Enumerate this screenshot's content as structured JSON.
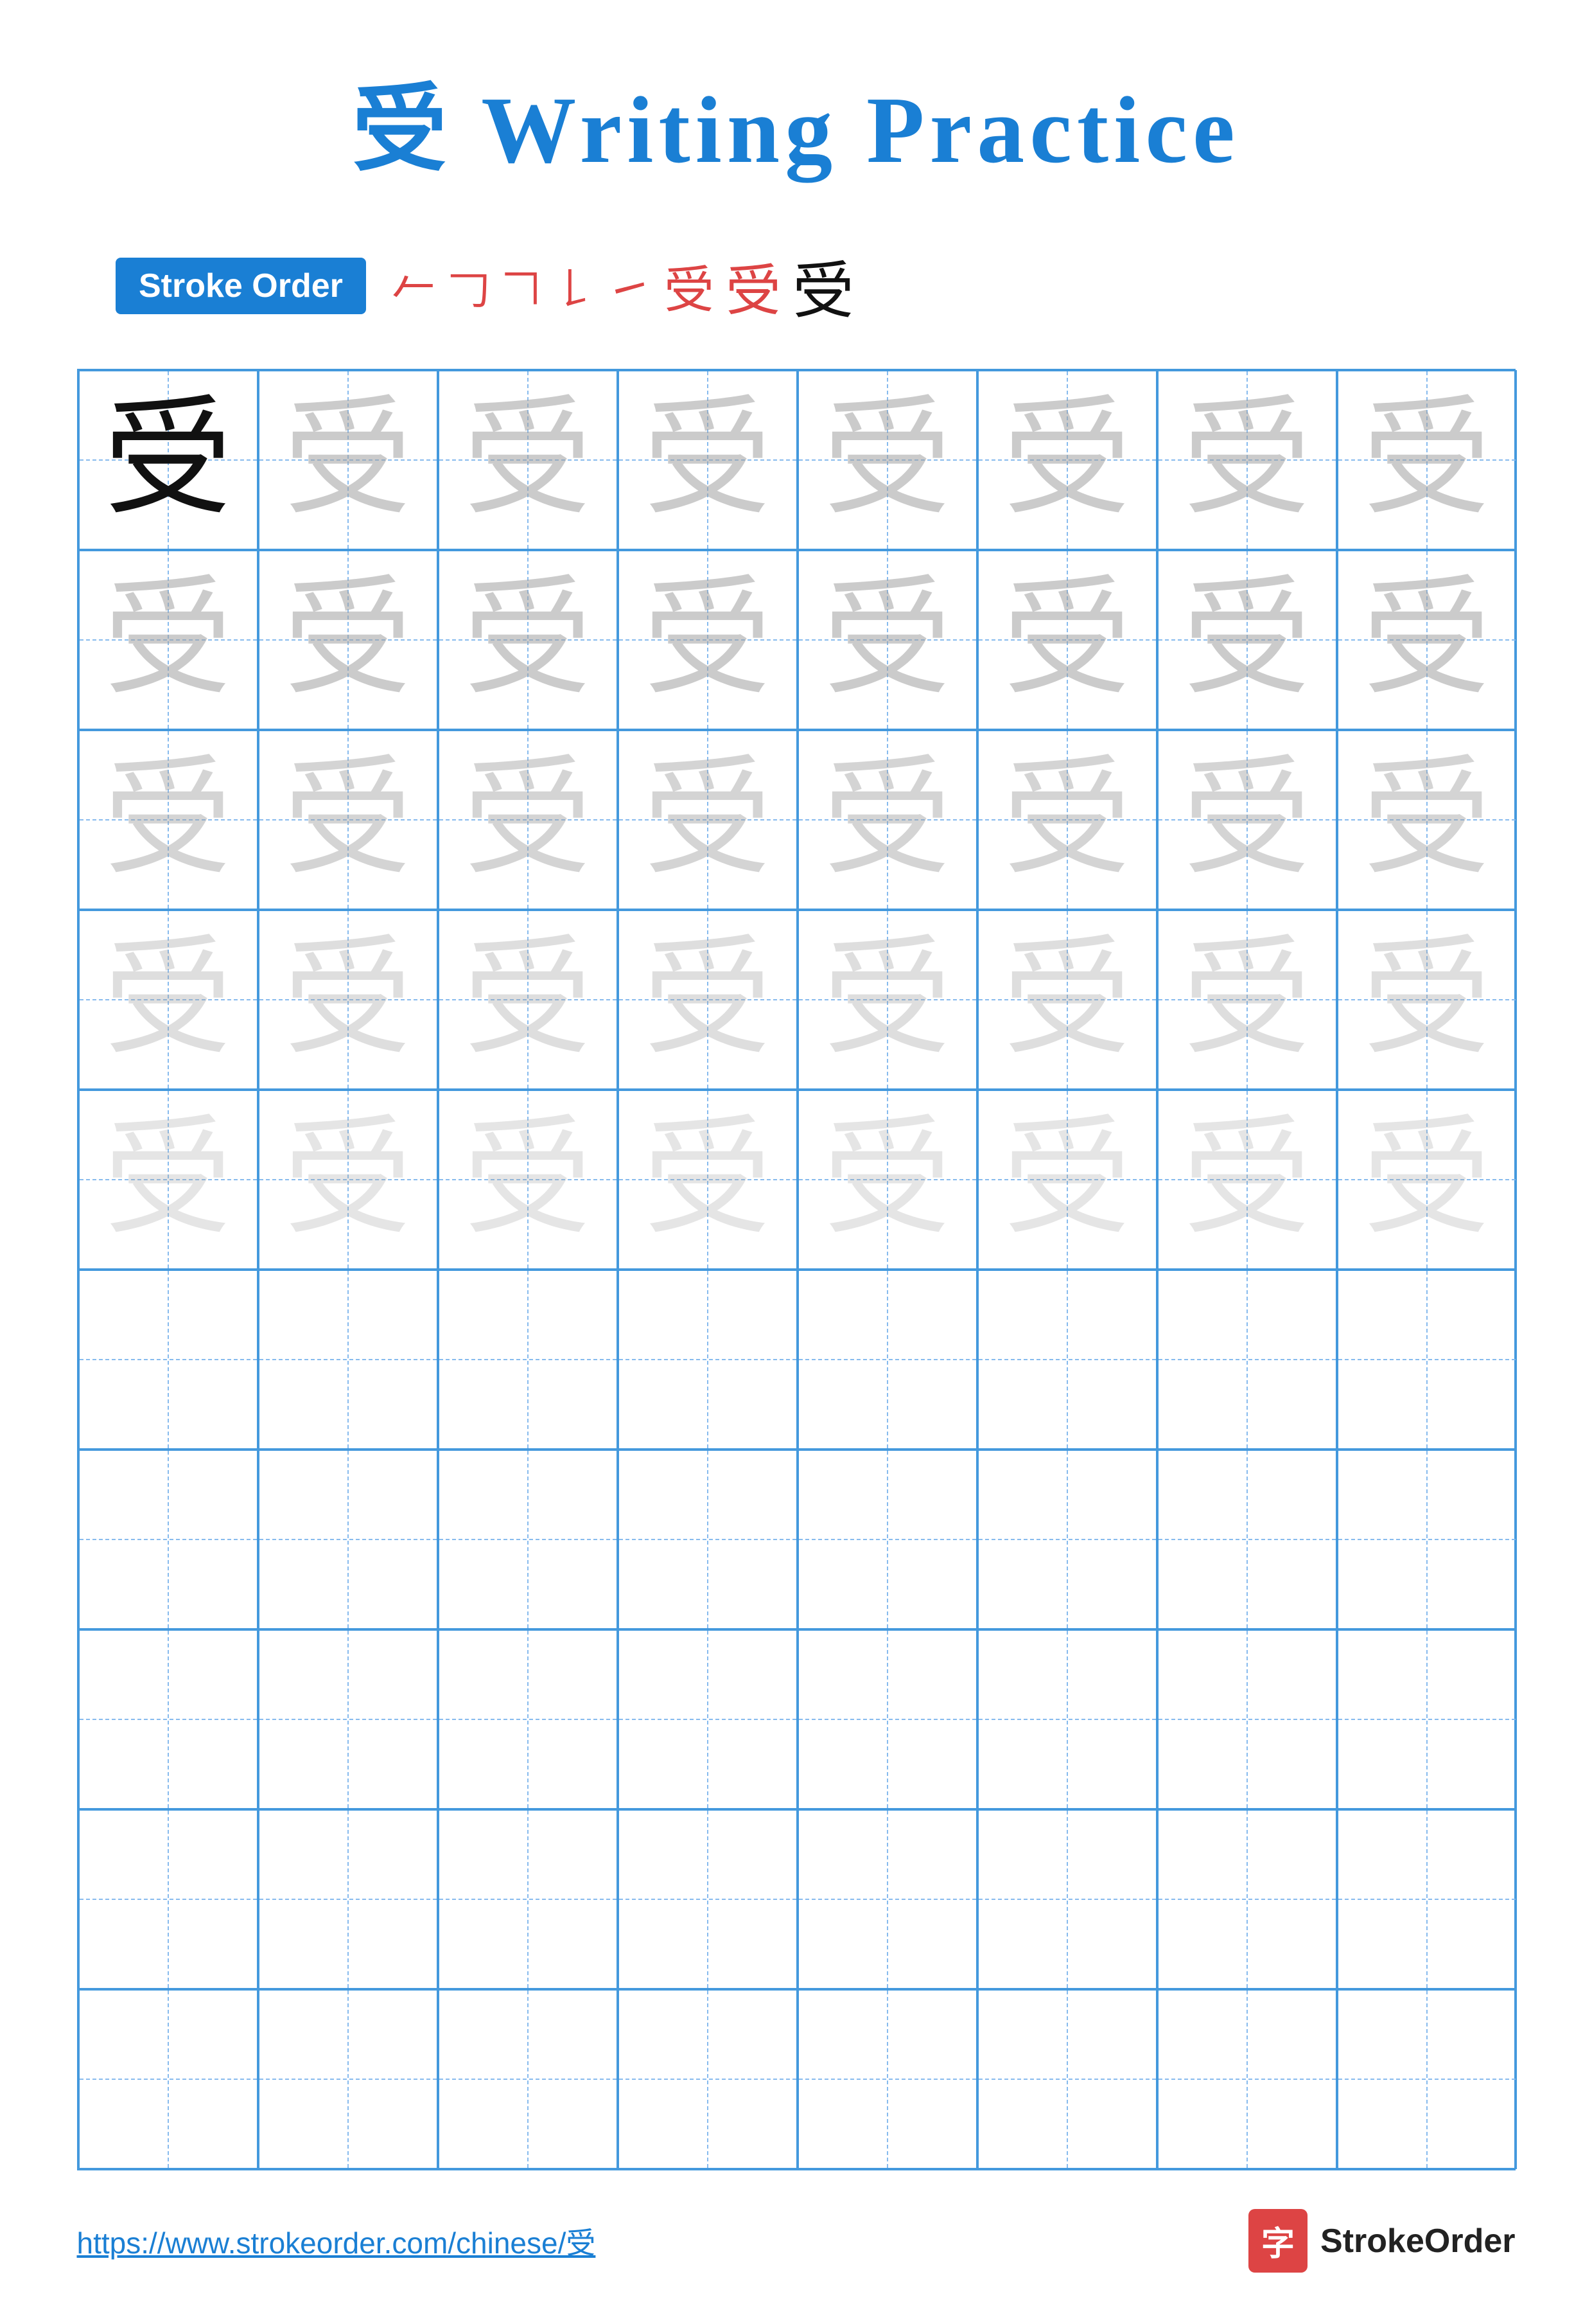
{
  "title": {
    "char": "受",
    "text": " Writing Practice"
  },
  "stroke_order": {
    "badge_label": "Stroke Order",
    "steps": [
      "⺂",
      "𠃌",
      "𠃍",
      "𠄌",
      "㇀",
      "受",
      "受",
      "受"
    ]
  },
  "grid": {
    "character": "受",
    "rows": 10,
    "cols": 8,
    "filled_rows": 5
  },
  "footer": {
    "url": "https://www.strokeorder.com/chinese/受",
    "logo_char": "字",
    "logo_text": "StrokeOrder"
  }
}
